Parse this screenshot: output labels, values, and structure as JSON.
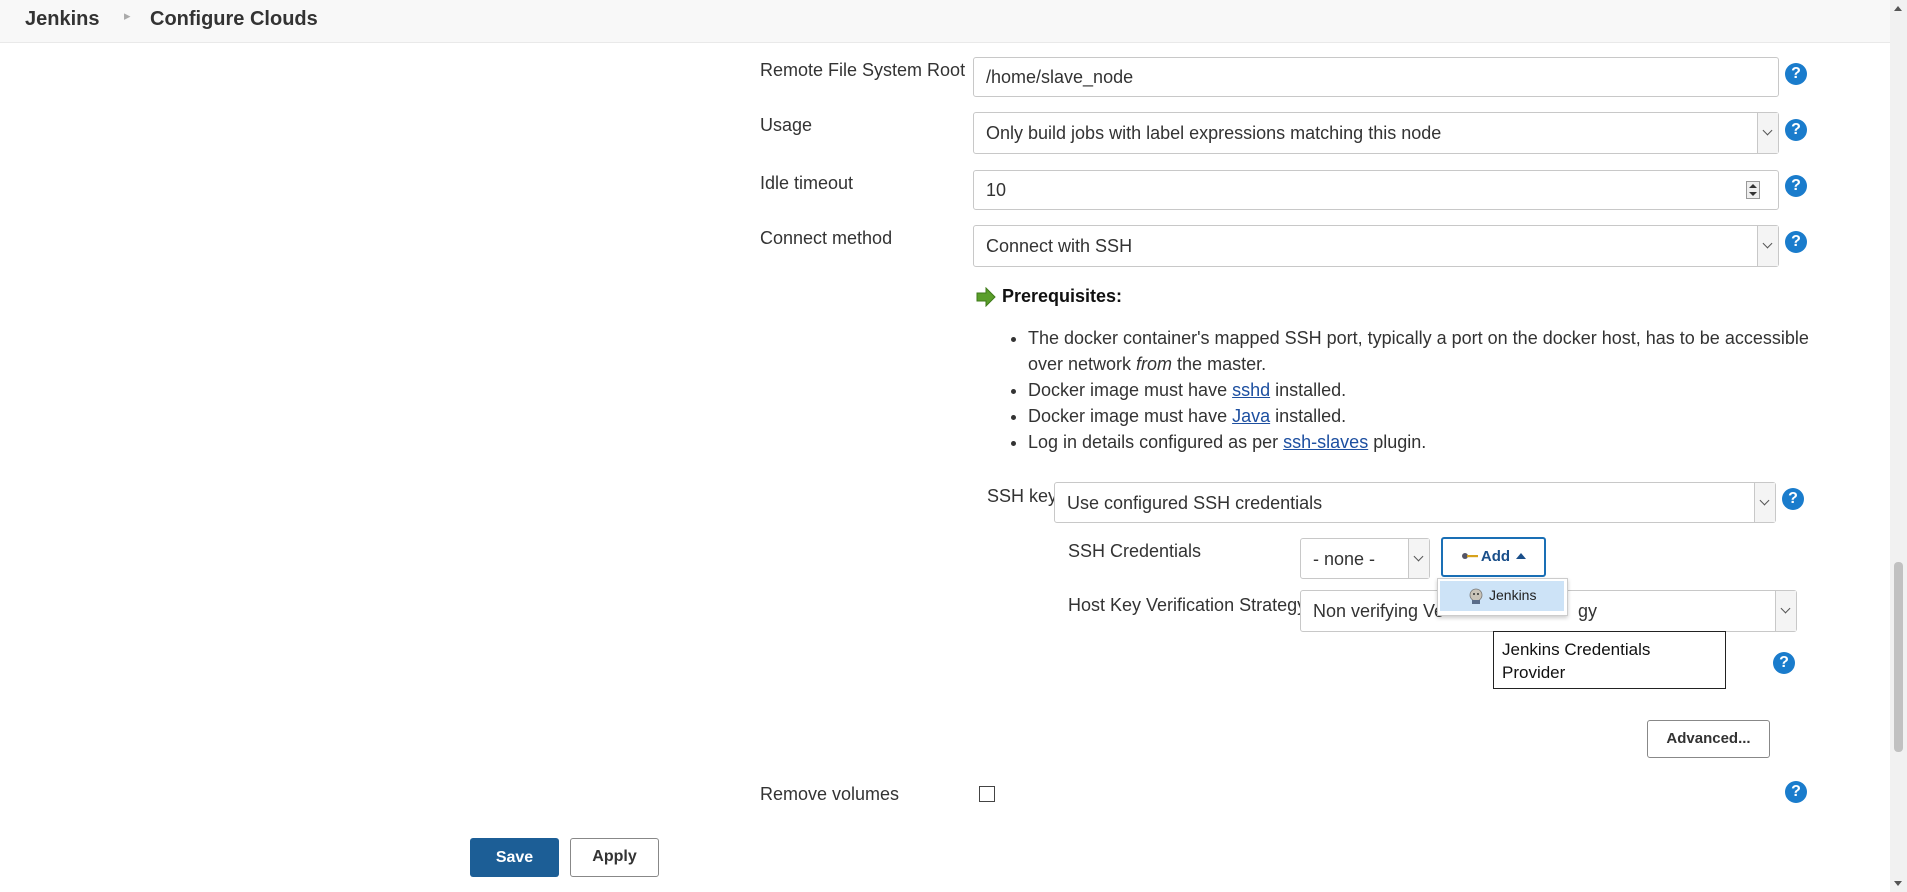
{
  "breadcrumb": {
    "home": "Jenkins",
    "current": "Configure Clouds"
  },
  "form": {
    "remote_fs_root": {
      "label": "Remote File System Root",
      "value": "/home/slave_node"
    },
    "usage": {
      "label": "Usage",
      "value": "Only build jobs with label expressions matching this node"
    },
    "idle_timeout": {
      "label": "Idle timeout",
      "value": "10"
    },
    "connect_method": {
      "label": "Connect method",
      "value": "Connect with SSH"
    },
    "prerequisites": {
      "title": "Prerequisites:",
      "items": [
        {
          "before": "The docker container's mapped SSH port, typically a port on the docker host, has to be accessible over network ",
          "em": "from",
          "after": " the master."
        },
        {
          "before": "Docker image must have ",
          "link": "sshd",
          "after": " installed."
        },
        {
          "before": "Docker image must have ",
          "link": "Java",
          "after": " installed."
        },
        {
          "before": "Log in details configured as per ",
          "link": "ssh-slaves",
          "after": " plugin."
        }
      ]
    },
    "ssh_key": {
      "label": "SSH key",
      "value": "Use configured SSH credentials"
    },
    "ssh_credentials": {
      "label": "SSH Credentials",
      "value": "- none -",
      "add_label": "Add"
    },
    "add_menu": {
      "item": "Jenkins"
    },
    "host_key": {
      "label": "Host Key Verification Strategy",
      "value_visible_left": "Non verifying Ve",
      "value_visible_right": "gy"
    },
    "tooltip": "Jenkins Credentials Provider",
    "advanced_label": "Advanced...",
    "remove_volumes": {
      "label": "Remove volumes",
      "checked": false
    },
    "help_glyph": "?"
  },
  "actions": {
    "save": "Save",
    "apply": "Apply"
  },
  "colors": {
    "accent": "#1a7ccc",
    "save_bg": "#1c5e96",
    "menu_highlight": "#cde3f7"
  }
}
